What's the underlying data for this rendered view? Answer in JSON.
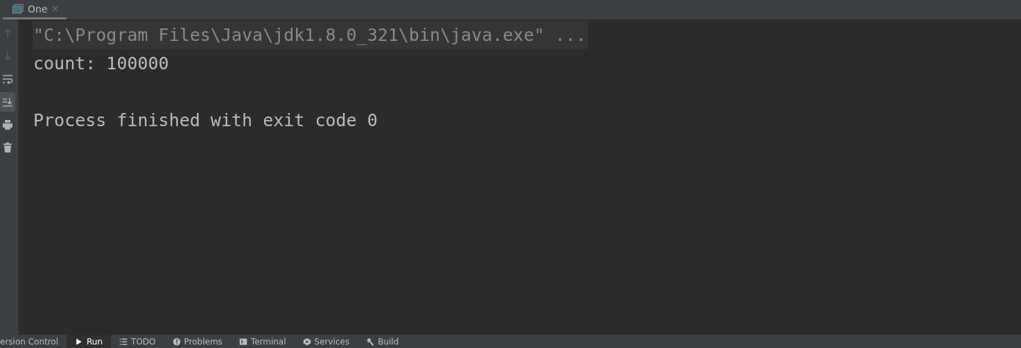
{
  "run_tabs": [
    {
      "label": "One",
      "selected": true
    }
  ],
  "toolbar": [
    {
      "kind": "up",
      "disabled": true,
      "selected": false
    },
    {
      "kind": "down",
      "disabled": true,
      "selected": false
    },
    {
      "kind": "wrap",
      "disabled": false,
      "selected": false
    },
    {
      "kind": "scroll-end",
      "disabled": false,
      "selected": true
    },
    {
      "kind": "print",
      "disabled": false,
      "selected": false
    },
    {
      "kind": "trash",
      "disabled": false,
      "selected": false
    }
  ],
  "console_lines": [
    {
      "text": "\"C:\\Program Files\\Java\\jdk1.8.0_321\\bin\\java.exe\" ...",
      "kind": "command"
    },
    {
      "text": "count: 100000",
      "kind": "output"
    },
    {
      "kind": "blank"
    },
    {
      "text": "Process finished with exit code 0",
      "kind": "output"
    }
  ],
  "tool_windows": [
    {
      "label": "ersion Control",
      "kind": "none",
      "selected": false
    },
    {
      "label": "Run",
      "kind": "run",
      "selected": true
    },
    {
      "label": "TODO",
      "kind": "list",
      "selected": false
    },
    {
      "label": "Problems",
      "kind": "problems",
      "selected": false
    },
    {
      "label": "Terminal",
      "kind": "terminal",
      "selected": false
    },
    {
      "label": "Services",
      "kind": "services",
      "selected": false
    },
    {
      "label": "Build",
      "kind": "build",
      "selected": false
    }
  ]
}
